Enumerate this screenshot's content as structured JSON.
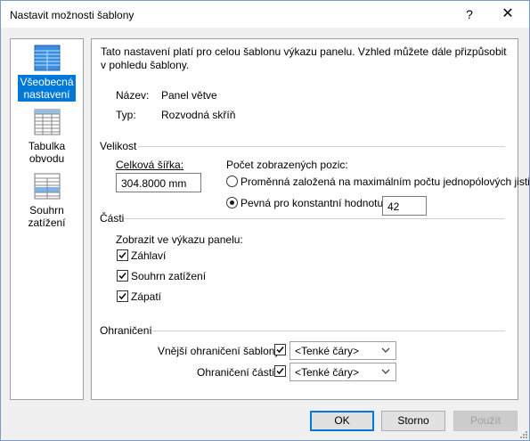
{
  "window": {
    "title": "Nastavit možnosti šablony",
    "help_glyph": "?",
    "close_glyph": "✕"
  },
  "nav": {
    "items": [
      {
        "label_line1": "Všeobecná",
        "label_line2": "nastavení",
        "icon": "table-blue-icon",
        "selected": true
      },
      {
        "label_line1": "Tabulka",
        "label_line2": "obvodu",
        "icon": "table-grid-icon",
        "selected": false
      },
      {
        "label_line1": "Souhrn",
        "label_line2": "zatížení",
        "icon": "table-summary-icon",
        "selected": false
      }
    ]
  },
  "content": {
    "intro": "Tato nastavení platí pro celou šablonu výkazu panelu. Vzhled můžete dále přizpůsobit v pohledu šablony.",
    "name_label": "Název:",
    "name_value": "Panel větve",
    "type_label": "Typ:",
    "type_value": "Rozvodná skříň",
    "size_group": "Velikost",
    "width_label": "Celková šířka:",
    "width_value": "304.8000 mm",
    "positions_label": "Počet zobrazených pozic:",
    "radio_variable": "Proměnná založená na maximálním počtu jednopólových jističů",
    "radio_fixed": "Pevná pro konstantní hodnotu:",
    "fixed_value": "42",
    "parts_group": "Části",
    "show_label": "Zobrazit ve výkazu panelu:",
    "check_header": "Záhlaví",
    "check_summary": "Souhrn zatížení",
    "check_footer": "Zápatí",
    "border_group": "Ohraničení",
    "outer_border_label": "Vnější ohraničení šablony:",
    "outer_border_value": "<Tenké čáry>",
    "part_border_label": "Ohraničení částí:",
    "part_border_value": "<Tenké čáry>"
  },
  "buttons": {
    "ok": "OK",
    "cancel": "Storno",
    "apply": "Použít"
  },
  "colors": {
    "accent": "#0078d7",
    "selected_bg": "#0078d7"
  }
}
